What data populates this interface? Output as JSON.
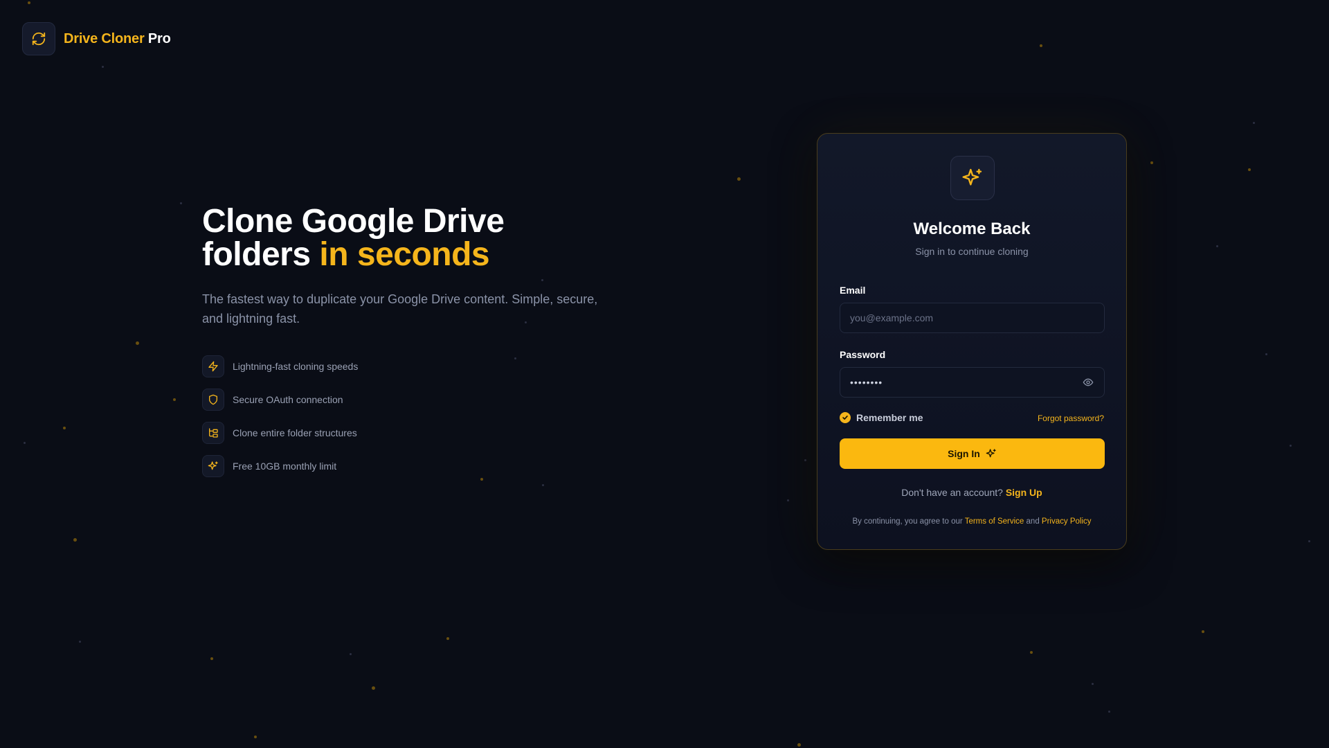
{
  "brand": {
    "name_accent": "Drive Cloner",
    "name_rest": "Pro",
    "icon": "refresh-icon"
  },
  "hero": {
    "title_line1": "Clone Google Drive",
    "title_line2_plain": "folders",
    "title_line2_accent": "in seconds",
    "subtitle": "The fastest way to duplicate your Google Drive content. Simple, secure, and lightning fast."
  },
  "features": [
    {
      "icon": "lightning-icon",
      "text": "Lightning-fast cloning speeds"
    },
    {
      "icon": "shield-icon",
      "text": "Secure OAuth connection"
    },
    {
      "icon": "folder-tree-icon",
      "text": "Clone entire folder structures"
    },
    {
      "icon": "sparkles-icon",
      "text": "Free 10GB monthly limit"
    }
  ],
  "login": {
    "icon": "sparkles-icon",
    "title": "Welcome Back",
    "subtitle": "Sign in to continue cloning",
    "email_label": "Email",
    "email_placeholder": "you@example.com",
    "email_value": "",
    "password_label": "Password",
    "password_value": "••••••••",
    "remember_label": "Remember me",
    "remember_checked": true,
    "forgot_label": "Forgot password?",
    "submit_label": "Sign In",
    "signup_prompt": "Don't have an account?",
    "signup_link": "Sign Up",
    "terms_prefix": "By continuing, you agree to our",
    "terms_link": "Terms of Service",
    "terms_and": "and",
    "privacy_link": "Privacy Policy"
  },
  "colors": {
    "background": "#0a0d16",
    "accent": "#f5b51c",
    "button": "#fbb80f",
    "card_border": "#4a3d1c"
  }
}
